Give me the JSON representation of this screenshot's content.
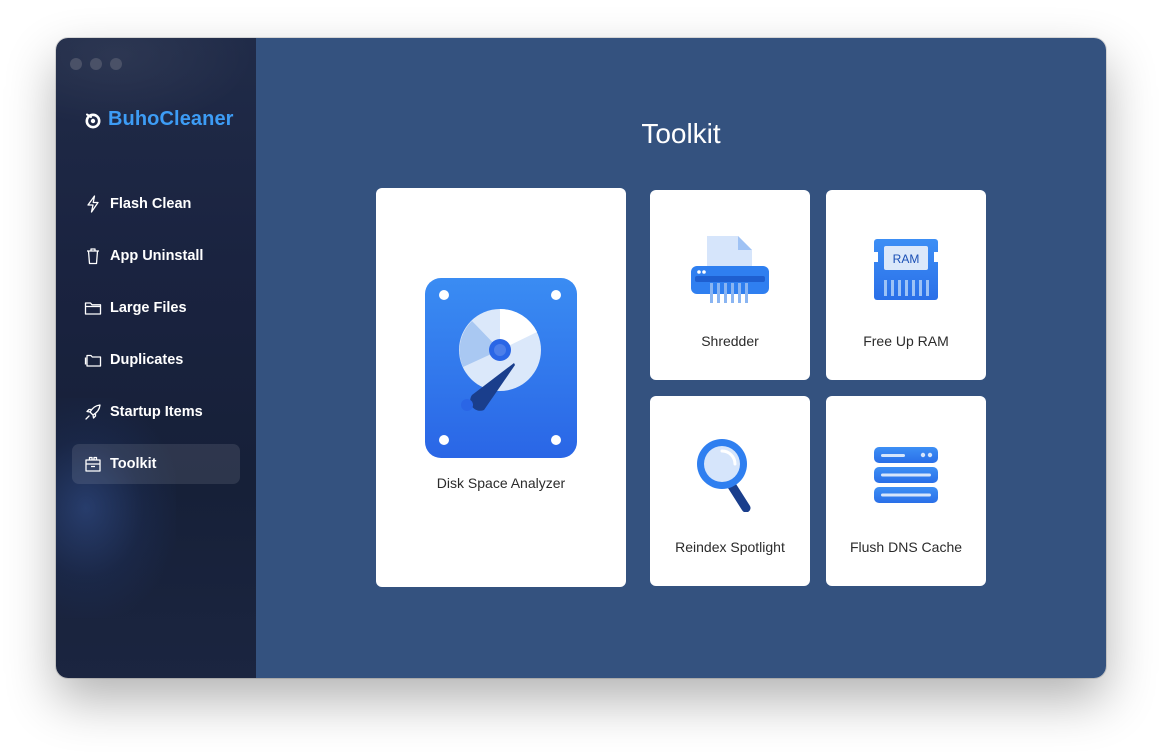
{
  "app": {
    "brand_name": "BuhoCleaner"
  },
  "sidebar": {
    "items": [
      {
        "label": "Flash Clean",
        "icon": "lightning-icon"
      },
      {
        "label": "App Uninstall",
        "icon": "trash-icon"
      },
      {
        "label": "Large Files",
        "icon": "folder-icon"
      },
      {
        "label": "Duplicates",
        "icon": "duplicate-folder-icon"
      },
      {
        "label": "Startup Items",
        "icon": "rocket-icon"
      },
      {
        "label": "Toolkit",
        "icon": "toolbox-icon",
        "active": true
      }
    ]
  },
  "main": {
    "title": "Toolkit",
    "tools": {
      "disk_space_analyzer": {
        "label": "Disk Space Analyzer",
        "icon": "hard-disk-icon"
      },
      "shredder": {
        "label": "Shredder",
        "icon": "shredder-icon"
      },
      "free_up_ram": {
        "label": "Free Up RAM",
        "icon": "ram-chip-icon",
        "chip_text": "RAM"
      },
      "reindex_spotlight": {
        "label": "Reindex Spotlight",
        "icon": "magnifier-icon"
      },
      "flush_dns_cache": {
        "label": "Flush DNS Cache",
        "icon": "server-icon"
      }
    }
  },
  "colors": {
    "main_bg": "#34527f",
    "sidebar_bg": "#1a2340",
    "brand_blue": "#3d9cf5",
    "card_bg": "#ffffff"
  }
}
